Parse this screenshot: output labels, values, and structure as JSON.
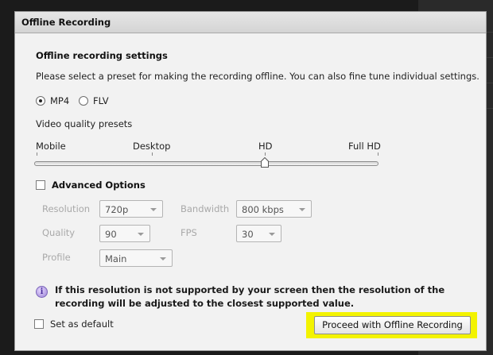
{
  "dialog": {
    "title": "Offline Recording",
    "section_title": "Offline recording settings",
    "description": "Please select a preset for making the recording offline. You can also fine tune individual settings.",
    "formats": [
      {
        "label": "MP4",
        "selected": true
      },
      {
        "label": "FLV",
        "selected": false
      }
    ],
    "presets_label": "Video quality presets",
    "presets": [
      "Mobile",
      "Desktop",
      "HD",
      "Full HD"
    ],
    "selected_preset": "HD",
    "advanced": {
      "label": "Advanced Options",
      "checked": false,
      "resolution_label": "Resolution",
      "resolution_value": "720p",
      "bandwidth_label": "Bandwidth",
      "bandwidth_value": "800 kbps",
      "quality_label": "Quality",
      "quality_value": "90",
      "fps_label": "FPS",
      "fps_value": "30",
      "profile_label": "Profile",
      "profile_value": "Main"
    },
    "notice": "If this resolution is not supported by your screen then the resolution of the recording will be adjusted to the closest supported value.",
    "default_label": "Set as default",
    "default_checked": false,
    "proceed_label": "Proceed with Offline Recording"
  },
  "colors": {
    "highlight": "#f3f300",
    "dialog_bg": "#f2f2f2",
    "screen_bg": "#1b1b1b"
  }
}
